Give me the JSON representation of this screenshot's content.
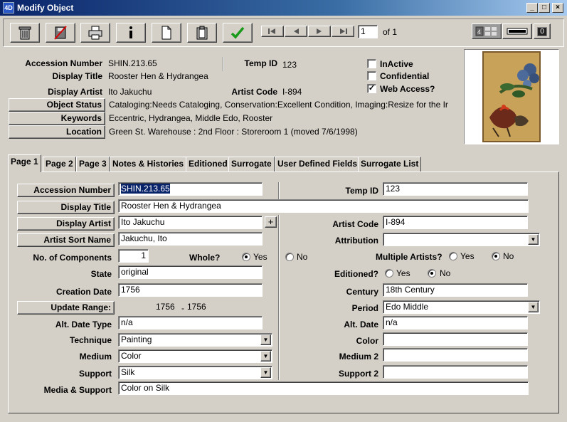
{
  "window": {
    "logo": "4D",
    "title": "Modify Object",
    "controls": [
      "_",
      "□",
      "×"
    ]
  },
  "toolbar": {
    "record_number": "1",
    "record_of": "of 1",
    "view_count": "0"
  },
  "header": {
    "accession_number_label": "Accession Number",
    "accession_number": "SHIN.213.65",
    "temp_id_label": "Temp ID",
    "temp_id": "123",
    "display_title_label": "Display Title",
    "display_title": "Rooster Hen & Hydrangea",
    "display_artist_label": "Display Artist",
    "display_artist": "Ito Jakuchu",
    "artist_code_label": "Artist Code",
    "artist_code": "I-894",
    "object_status_label": "Object Status",
    "object_status": "Cataloging:Needs Cataloging, Conservation:Excellent Condition, Imaging:Resize for the Ir",
    "keywords_label": "Keywords",
    "keywords": "Eccentric, Hydrangea, Middle Edo, Rooster",
    "location_label": "Location",
    "location": "Green St. Warehouse : 2nd Floor : Storeroom 1 (moved 7/6/1998)",
    "inactive_label": "InActive",
    "inactive": false,
    "confidential_label": "Confidential",
    "confidential": false,
    "web_access_label": "Web Access?",
    "web_access": true,
    "check_mark": "✓"
  },
  "tabs": [
    "Page 1",
    "Page 2",
    "Page 3",
    "Notes & Histories",
    "Editioned",
    "Surrogate",
    "User Defined Fields",
    "Surrogate List"
  ],
  "active_tab": "Page 1",
  "form": {
    "accession_number_label": "Accession Number",
    "accession_number": "SHIN.213.65",
    "temp_id_label": "Temp ID",
    "temp_id": "123",
    "display_title_label": "Display Title",
    "display_title": "Rooster Hen & Hydrangea",
    "display_artist_label": "Display Artist",
    "display_artist": "Ito Jakuchu",
    "add_artist": "+",
    "artist_code_label": "Artist Code",
    "artist_code": "I-894",
    "artist_sort_name_label": "Artist Sort Name",
    "artist_sort_name": "Jakuchu, Ito",
    "attribution_label": "Attribution",
    "attribution": "",
    "components_label": "No. of Components",
    "components": "1",
    "whole_label": "Whole?",
    "whole_yes": "Yes",
    "whole_no": "No",
    "whole": "Yes",
    "multiple_artists_label": "Multiple Artists?",
    "multiple_yes": "Yes",
    "multiple_no": "No",
    "multiple_artists": "No",
    "state_label": "State",
    "state": "original",
    "editioned_label": "Editioned?",
    "editioned_yes": "Yes",
    "editioned_no": "No",
    "editioned": "No",
    "creation_date_label": "Creation Date",
    "creation_date": "1756",
    "century_label": "Century",
    "century": "18th Century",
    "update_range_label": "Update Range:",
    "range_start": "1756",
    "range_sep": "-",
    "range_end": "1756",
    "period_label": "Period",
    "period": "Edo Middle",
    "alt_date_type_label": "Alt. Date Type",
    "alt_date_type": "n/a",
    "alt_date_label": "Alt. Date",
    "alt_date": "n/a",
    "technique_label": "Technique",
    "technique": "Painting",
    "color_label": "Color",
    "color": "",
    "medium_label": "Medium",
    "medium": "Color",
    "medium2_label": "Medium 2",
    "medium2": "",
    "support_label": "Support",
    "support": "Silk",
    "support2_label": "Support 2",
    "support2": "",
    "media_support_label": "Media & Support",
    "media_support": "Color on Silk",
    "dropdown_arrow": "▼"
  }
}
